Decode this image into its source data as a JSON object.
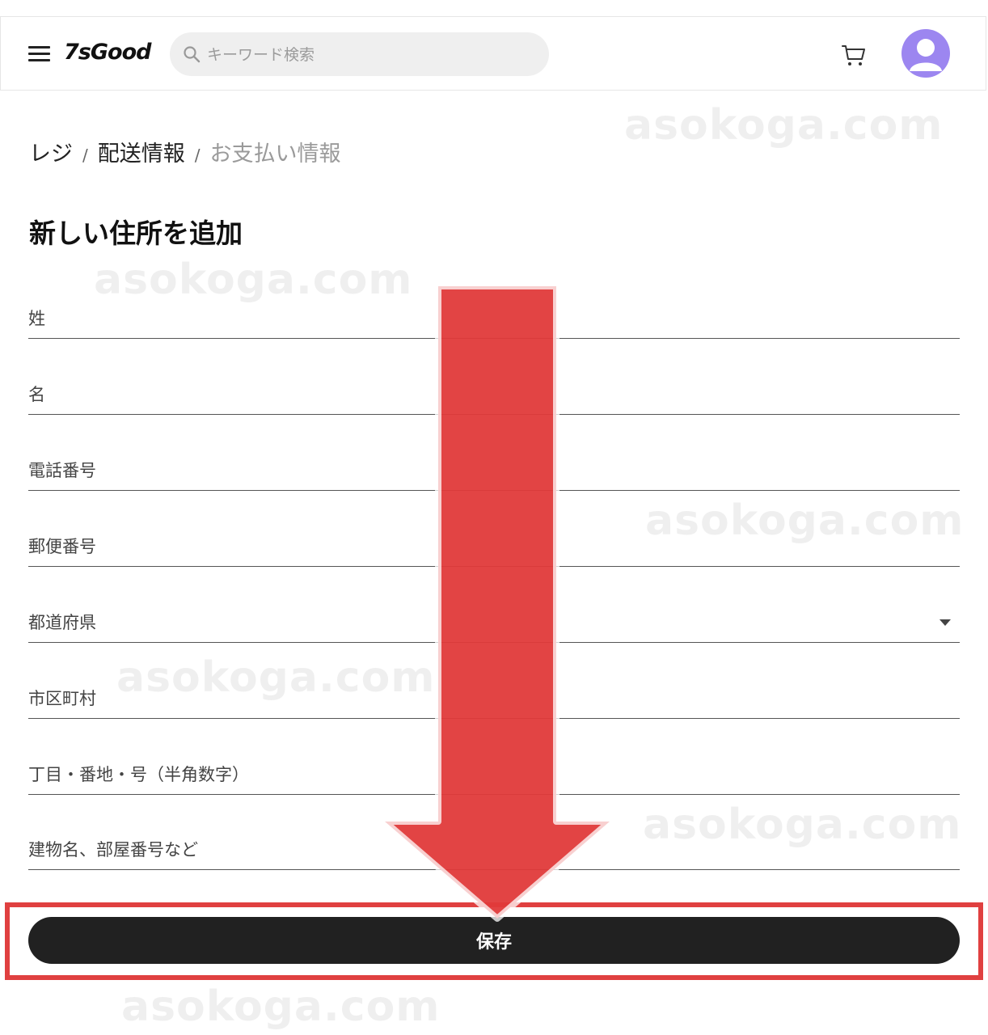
{
  "header": {
    "logo": "7sGood",
    "search": {
      "placeholder": "キーワード検索",
      "value": ""
    },
    "icons": {
      "menu": "hamburger-menu-icon",
      "search": "search-icon",
      "cart": "cart-icon",
      "avatar": "user-avatar-icon"
    }
  },
  "breadcrumb": {
    "items": [
      "レジ",
      "配送情報",
      "お支払い情報"
    ],
    "separator": "/"
  },
  "form": {
    "title": "新しい住所を追加",
    "fields": [
      {
        "placeholder": "姓"
      },
      {
        "placeholder": "名"
      },
      {
        "placeholder": "電話番号"
      },
      {
        "placeholder": "郵便番号"
      },
      {
        "placeholder": "都道府県",
        "type": "select"
      },
      {
        "placeholder": "市区町村"
      },
      {
        "placeholder": "丁目・番地・号（半角数字）"
      },
      {
        "placeholder": "建物名、部屋番号など"
      }
    ],
    "save_label": "保存"
  },
  "watermark": "asokoga.com",
  "colors": {
    "accent": "#e04040",
    "button": "#212121",
    "avatar": "#9c86f0"
  }
}
